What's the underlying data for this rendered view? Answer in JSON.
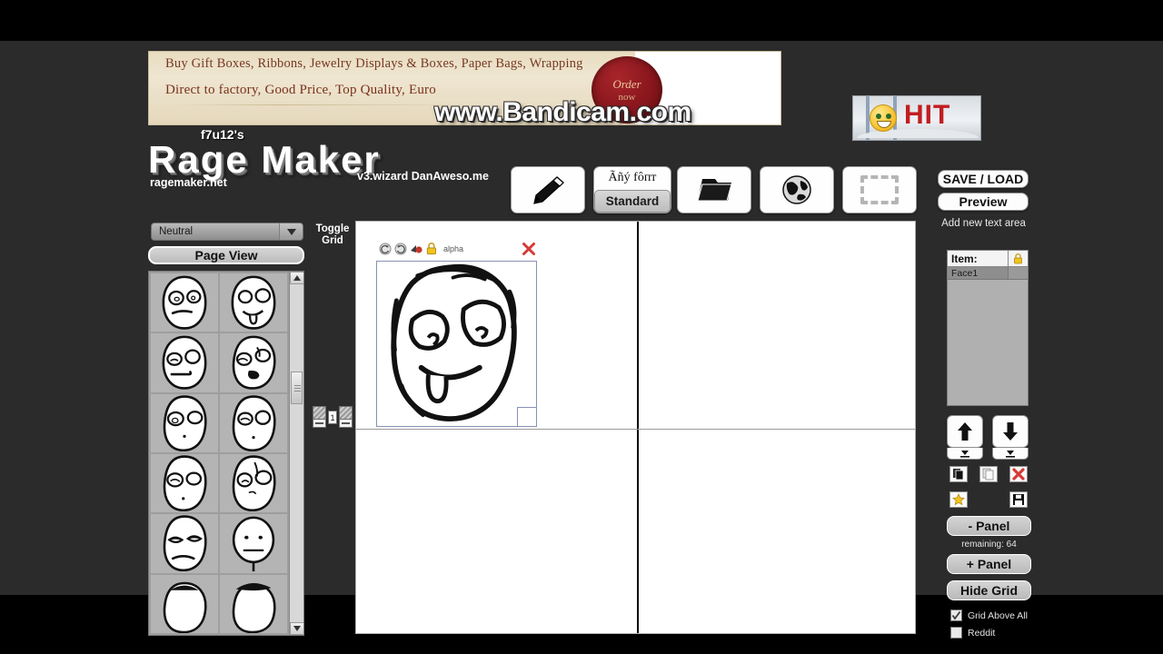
{
  "app": {
    "brand_prefix": "f7u12's",
    "title": "Rage Maker",
    "domain": "ragemaker.net",
    "version": "v3.wizard  DanAweso.me"
  },
  "ad": {
    "line1": "Buy Gift Boxes, Ribbons, Jewelry Displays & Boxes, Paper Bags, Wrapping",
    "line2": "Direct to factory, Good Price, Top Quality, Euro",
    "seal_line1": "Order",
    "seal_line2": "now",
    "watermark": "www.Bandicam.com",
    "hit_text": "HIT"
  },
  "toolbar": {
    "pencil_icon": "pencil-icon",
    "font_sample": "Ãñý fôпт",
    "font_style": "Standard",
    "folder_icon": "folder-icon",
    "globe_icon": "globe-icon",
    "select_icon": "dashed-selection-icon"
  },
  "right_panel": {
    "save_load": "SAVE / LOAD",
    "preview": "Preview",
    "add_text_area": "Add new text area",
    "item_header": "Item:",
    "lock_icon": "lock-icon",
    "items": [
      {
        "name": "Face1",
        "locked": false
      }
    ],
    "move_up_icon": "arrow-up-icon",
    "move_down_icon": "arrow-down-icon",
    "send_top_icon": "send-to-top-icon",
    "send_bottom_icon": "send-to-bottom-icon",
    "copy_icon": "copy-icon",
    "paste_icon": "paste-icon",
    "delete_icon": "delete-x-icon",
    "star_icon": "star-icon",
    "save_icon": "floppy-save-icon",
    "minus_panel": "- Panel",
    "remaining": "remaining: 64",
    "plus_panel": "+ Panel",
    "hide_grid": "Hide Grid",
    "grid_above_all": "Grid Above All",
    "grid_above_all_checked": true,
    "reddit": "Reddit",
    "reddit_checked": false
  },
  "sidebar": {
    "mood_selected": "Neutral",
    "page_view": "Page View",
    "toggle_grid_line1": "Toggle",
    "toggle_grid_line2": "Grid",
    "panel_count": "1"
  },
  "canvas": {
    "selection": {
      "rotate_left_icon": "rotate-left-icon",
      "rotate_right_icon": "rotate-right-icon",
      "flip_icon": "flip-color-icon",
      "lock_icon": "lock-icon",
      "alpha_label": "alpha",
      "close_icon": "close-x-icon"
    }
  }
}
